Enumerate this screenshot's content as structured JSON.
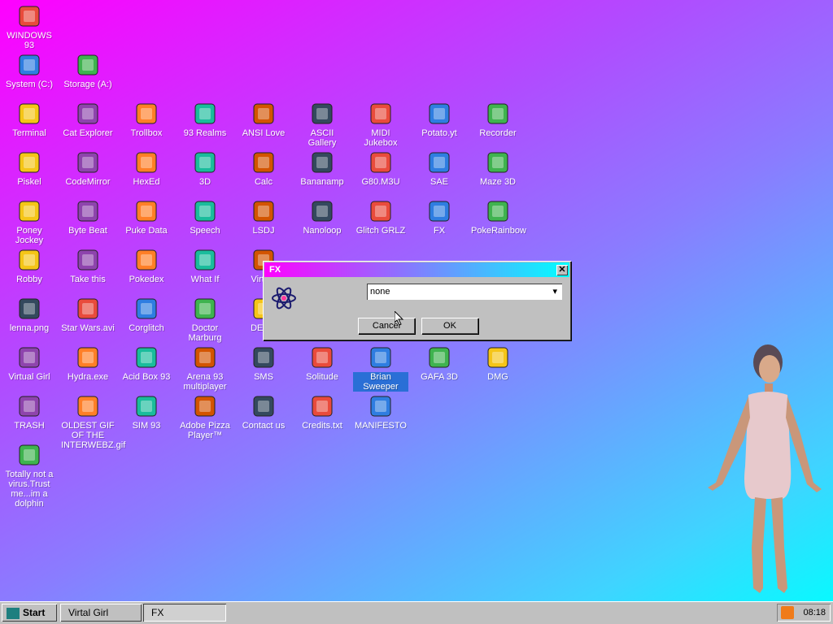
{
  "desktop": {
    "icons": [
      {
        "label": "WINDOWS 93",
        "icon": "computer-icon"
      },
      {
        "label": "System (C:)",
        "icon": "drive-icon"
      },
      {
        "label": "Storage (A:)",
        "icon": "floppy-drive-icon"
      },
      {
        "label": "Terminal",
        "icon": "terminal-icon"
      },
      {
        "label": "Cat Explorer",
        "icon": "cat-globe-icon"
      },
      {
        "label": "Trollbox",
        "icon": "chat-icon"
      },
      {
        "label": "93 Realms",
        "icon": "realms-icon"
      },
      {
        "label": "ANSI Love",
        "icon": "ansi-icon"
      },
      {
        "label": "ASCII Gallery",
        "icon": "ascii-icon"
      },
      {
        "label": "MIDI Jukebox",
        "icon": "piano-icon"
      },
      {
        "label": "Potato.yt",
        "icon": "potato-icon"
      },
      {
        "label": "Recorder",
        "icon": "microphone-icon"
      },
      {
        "label": "Piskel",
        "icon": "palette-icon"
      },
      {
        "label": "CodeMirror",
        "icon": "codemirror-icon"
      },
      {
        "label": "HexEd",
        "icon": "cube-icon"
      },
      {
        "label": "3D",
        "icon": "teapot-icon"
      },
      {
        "label": "Calc",
        "icon": "calculator-icon"
      },
      {
        "label": "Bananamp",
        "icon": "banana-icon"
      },
      {
        "label": "G80.M3U",
        "icon": "audio-file-icon"
      },
      {
        "label": "SAE",
        "icon": "amiga-ball-icon"
      },
      {
        "label": "Maze 3D",
        "icon": "maze-icon"
      },
      {
        "label": "Poney Jockey",
        "icon": "pony-icon"
      },
      {
        "label": "Byte Beat",
        "icon": "bytebeat-icon"
      },
      {
        "label": "Puke Data",
        "icon": "puredata-icon"
      },
      {
        "label": "Speech",
        "icon": "face-icon"
      },
      {
        "label": "LSDJ",
        "icon": "lsdj-icon"
      },
      {
        "label": "Nanoloop",
        "icon": "wave-icon"
      },
      {
        "label": "Glitch GRLZ",
        "icon": "lips-icon"
      },
      {
        "label": "FX",
        "icon": "atom-icon"
      },
      {
        "label": "PokeRainbow",
        "icon": "poke-icon"
      },
      {
        "label": "Robby",
        "icon": "stickman-icon"
      },
      {
        "label": "Take this",
        "icon": "pixel-guy-icon"
      },
      {
        "label": "Pokedex",
        "icon": "pokedex-icon"
      },
      {
        "label": "What If",
        "icon": "whatif-icon"
      },
      {
        "label": "Virtual",
        "icon": "virtual-icon"
      },
      {
        "label": "lenna.png",
        "icon": "image-file-icon"
      },
      {
        "label": "Star Wars.avi",
        "icon": "yoda-icon"
      },
      {
        "label": "Corglitch",
        "icon": "corgi-icon"
      },
      {
        "label": "Doctor Marburg",
        "icon": "doctor-icon"
      },
      {
        "label": "DERG",
        "icon": "derg-icon"
      },
      {
        "label": "Virtual Girl",
        "icon": "girl-face-icon"
      },
      {
        "label": "Hydra.exe",
        "icon": "hydra-icon"
      },
      {
        "label": "Acid Box 93",
        "icon": "smiley-icon"
      },
      {
        "label": "Arena 93 multiplayer",
        "icon": "arena-cube-icon"
      },
      {
        "label": "SMS",
        "icon": "sms-icon"
      },
      {
        "label": "Solitude",
        "icon": "solitude-icon"
      },
      {
        "label": "Brian Sweeper",
        "icon": "mine-icon"
      },
      {
        "label": "GAFA 3D",
        "icon": "gafa-icon"
      },
      {
        "label": "DMG",
        "icon": "gameboy-icon"
      },
      {
        "label": "TRASH",
        "icon": "trash-icon"
      },
      {
        "label": "OLDEST GIF OF THE INTERWEBZ.gif",
        "icon": "gif-file-icon"
      },
      {
        "label": "SIM 93",
        "icon": "sim-icon"
      },
      {
        "label": "Adobe Pizza Player™",
        "icon": "pizza-icon"
      },
      {
        "label": "Contact us",
        "icon": "contact-icon"
      },
      {
        "label": "Credits.txt",
        "icon": "text-file-icon"
      },
      {
        "label": "MANIFESTO",
        "icon": "question-icon"
      },
      {
        "label": "Totally not a virus.Trust me...im a dolphin",
        "icon": "dolphin-icon"
      }
    ]
  },
  "dialog": {
    "title": "FX",
    "select_value": "none",
    "cancel_label": "Cancel",
    "ok_label": "OK"
  },
  "taskbar": {
    "start_label": "Start",
    "tasks": [
      "Virtal Girl",
      "FX"
    ],
    "clock": "08:18"
  },
  "colors": {
    "bg_from": "#ff00ff",
    "bg_to": "#00ffff",
    "selection": "#2a6fd6"
  }
}
